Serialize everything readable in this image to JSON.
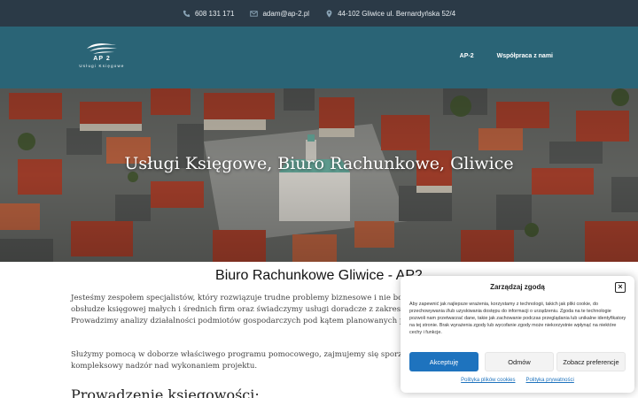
{
  "topbar": {
    "phone": "608 131 171",
    "email": "adam@ap-2.pl",
    "address": "44-102 Gliwice ul. Bernardyńska 52/4",
    "icons": [
      "phone-icon",
      "envelope-icon",
      "map-pin-icon"
    ]
  },
  "header": {
    "logo_name": "AP 2",
    "logo_tagline": "Usługi Księgowe",
    "nav": [
      {
        "label": "AP-2"
      },
      {
        "label": "Współpraca z nami"
      }
    ]
  },
  "hero": {
    "title": "Usługi Księgowe, Biuro Rachunkowe, Gliwice"
  },
  "main": {
    "heading": "Biuro Rachunkowe Gliwice - AP2",
    "paragraph1": "Jesteśmy zespołem specjalistów, który rozwiązuje trudne problemy biznesowe i nie boi się wyzwań. Specjalizujemy się w kompleksowej obsłudze księgowej małych i średnich firm oraz świadczymy usługi doradcze z zakresu księgowości i finansów przedsiębiorstw. Prowadzimy analizy działalności podmiotów gospodarczych pod kątem planowanych przedsięwzięcia inwestycyjne.",
    "paragraph2": "Służymy pomocą w doborze właściwego programu pomocowego, zajmujemy się sporządzaniem biznes planów oraz prowadzimy kompleksowy nadzór nad wykonaniem projektu.",
    "subheading": "Prowadzenie księgowości:"
  },
  "cookie": {
    "title": "Zarządzaj zgodą",
    "text": "Aby zapewnić jak najlepsze wrażenia, korzystamy z technologii, takich jak pliki cookie, do przechowywania i/lub uzyskiwania dostępu do informacji o urządzeniu. Zgoda na te technologie pozwoli nam przetwarzać dane, takie jak zachowanie podczas przeglądania lub unikalne identyfikatory na tej stronie. Brak wyrażenia zgody lub wycofanie zgody może niekorzystnie wpłynąć na niektóre cechy i funkcje.",
    "accept": "Akceptuję",
    "deny": "Odmów",
    "preferences": "Zobacz preferencje",
    "link_cookies": "Polityka plików cookies",
    "link_privacy": "Polityka prywatności",
    "accent_color": "#1e73be"
  },
  "colors": {
    "topbar": "#2b3a47",
    "navbar": "#2a6476"
  }
}
